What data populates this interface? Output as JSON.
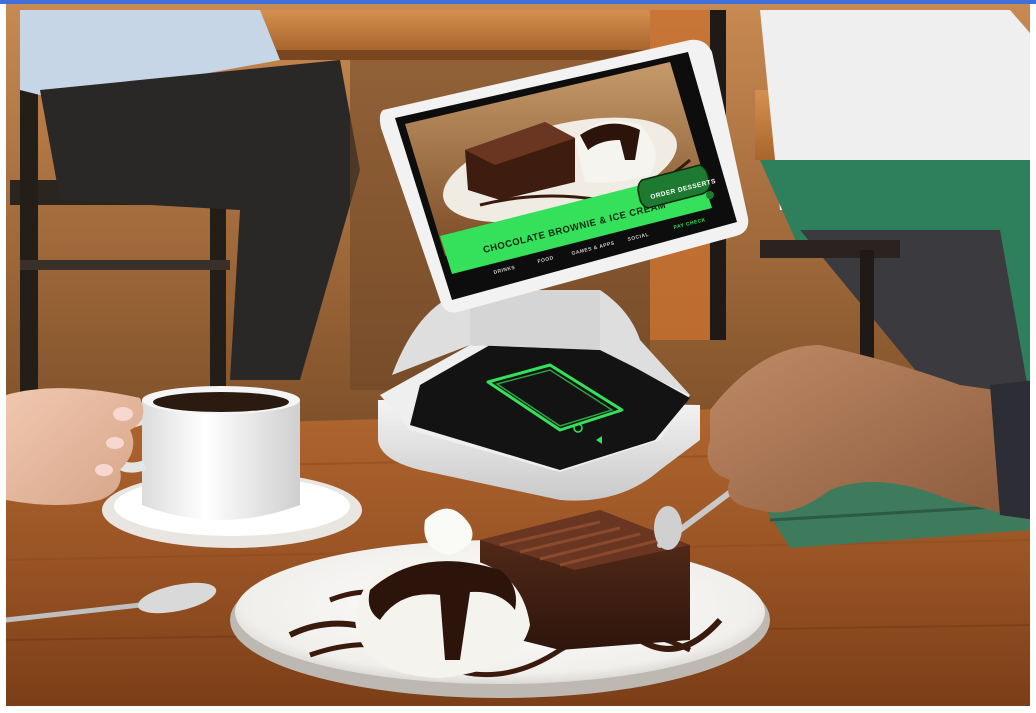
{
  "kiosk": {
    "item_title": "CHOCOLATE BROWNIE & ICE CREAM",
    "order_button": "ORDER DESSERTS",
    "nav": [
      "DRINKS",
      "FOOD",
      "GAMES & APPS",
      "SOCIAL",
      "PAY CHECK"
    ],
    "accent_color": "#35e05a"
  }
}
